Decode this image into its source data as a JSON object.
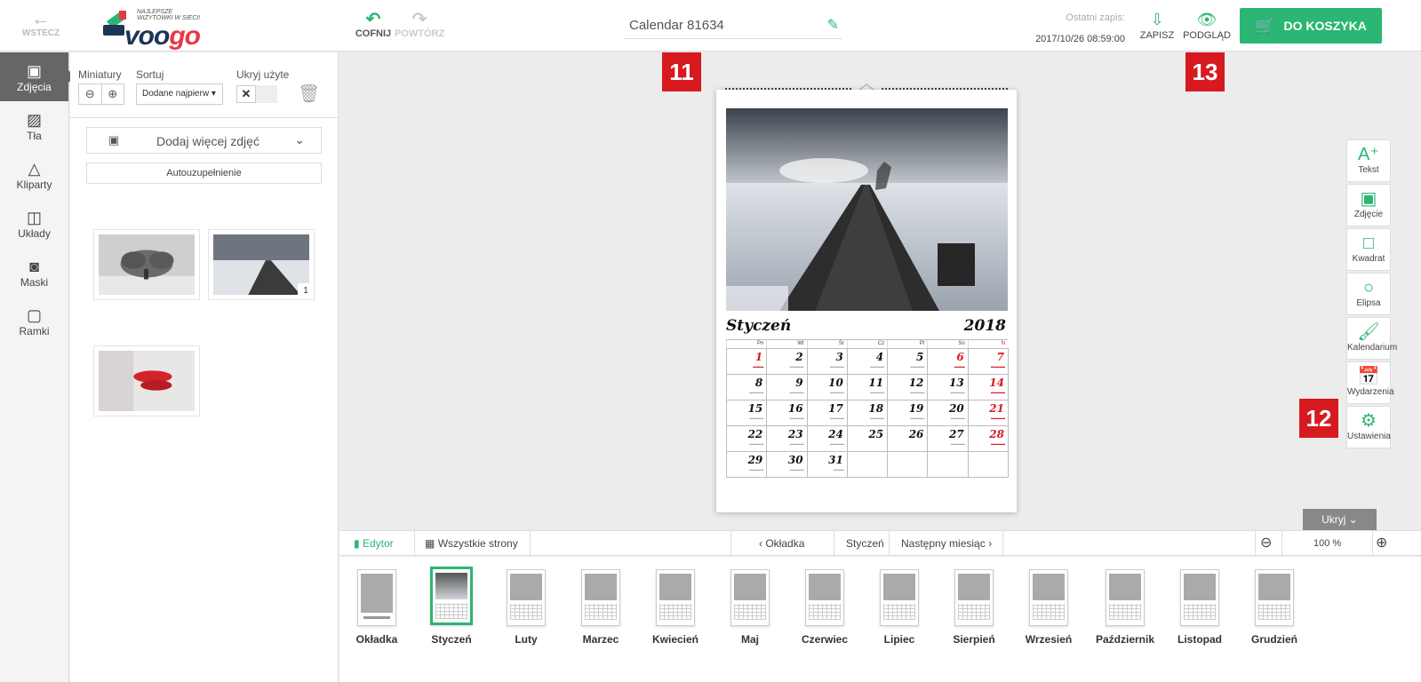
{
  "topbar": {
    "back_label": "WSTECZ",
    "logo_tag": "NAJLEPSZE WIZYTÓWKI W SIECI!",
    "logo_text_a": "voo",
    "logo_text_b": "go",
    "undo_label": "COFNIJ",
    "redo_label": "POWTÓRZ",
    "project_title": "Calendar 81634",
    "last_save_label": "Ostatni zapis:",
    "last_save_value": "2017/10/26 08:59:00",
    "save_label": "ZAPISZ",
    "preview_label": "PODGLĄD",
    "cart_label": "DO KOSZYKA"
  },
  "badges": {
    "b11": "11",
    "b12": "12",
    "b13": "13"
  },
  "leftnav": [
    {
      "label": "Zdjęcia",
      "icon": "image-icon"
    },
    {
      "label": "Tła",
      "icon": "background-icon"
    },
    {
      "label": "Kliparty",
      "icon": "shapes-icon"
    },
    {
      "label": "Układy",
      "icon": "layout-icon"
    },
    {
      "label": "Maski",
      "icon": "mask-icon"
    },
    {
      "label": "Ramki",
      "icon": "frame-icon"
    }
  ],
  "panel": {
    "thumbs_label": "Miniatury",
    "sort_label": "Sortuj",
    "hide_used_label": "Ukryj użyte",
    "sort_value": "Dodane najpierw",
    "add_more_label": "Dodaj więcej zdjęć",
    "autofill_label": "Autouzupełnienie",
    "used_count": "1"
  },
  "calendar": {
    "month": "Styczeń",
    "year": "2018",
    "weekdays": [
      "Pn",
      "Wt",
      "Śr",
      "Cz",
      "Pt",
      "So",
      "N"
    ],
    "weeks": [
      [
        "1",
        "2",
        "3",
        "4",
        "5",
        "6",
        "7"
      ],
      [
        "8",
        "9",
        "10",
        "11",
        "12",
        "13",
        "14"
      ],
      [
        "15",
        "16",
        "17",
        "18",
        "19",
        "20",
        "21"
      ],
      [
        "22",
        "23",
        "24",
        "25",
        "26",
        "27",
        "28"
      ],
      [
        "29",
        "30",
        "31",
        "",
        "",
        "",
        ""
      ]
    ]
  },
  "rtools": [
    {
      "label": "Tekst",
      "icon": "text-add-icon"
    },
    {
      "label": "Zdjęcie",
      "icon": "image-add-icon"
    },
    {
      "label": "Kwadrat",
      "icon": "square-icon"
    },
    {
      "label": "Elipsa",
      "icon": "ellipse-icon"
    },
    {
      "label": "Kalendarium",
      "icon": "brush-icon"
    },
    {
      "label": "Wydarzenia",
      "icon": "calendar-event-icon"
    },
    {
      "label": "Ustawienia",
      "icon": "gears-icon"
    }
  ],
  "hide_label": "Ukryj",
  "bottombar": {
    "editor": "Edytor",
    "all_pages": "Wszystkie strony",
    "prev": "Okładka",
    "current": "Styczeń",
    "next": "Następny miesiąc",
    "zoom": "100 %"
  },
  "pages": [
    "Okładka",
    "Styczeń",
    "Luty",
    "Marzec",
    "Kwiecień",
    "Maj",
    "Czerwiec",
    "Lipiec",
    "Sierpień",
    "Wrzesień",
    "Październik",
    "Listopad",
    "Grudzień"
  ]
}
